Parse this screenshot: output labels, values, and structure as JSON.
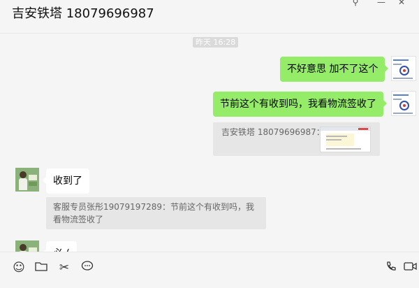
{
  "header": {
    "title": "吉安铁塔 18079696987"
  },
  "window_controls": {
    "pin_icon": "pin-icon",
    "minimize_icon": "minimize-icon",
    "close_icon": "close-icon"
  },
  "chat": {
    "time_label": "昨天 16:28",
    "messages": [
      {
        "side": "right",
        "text": "不好意思 加不了这个"
      },
      {
        "side": "right",
        "text": "节前这个有收到吗，我看物流签收了"
      },
      {
        "side": "right-quote",
        "text": "吉安铁塔 18079696987："
      },
      {
        "side": "left",
        "text": "收到了"
      },
      {
        "side": "left-quote",
        "text": "客服专员张彤19079197289：节前这个有收到吗，我看物流签收了"
      },
      {
        "side": "left",
        "text": "必 ("
      }
    ]
  },
  "toolbar": {
    "icons": [
      "emoji-icon",
      "folder-icon",
      "screenshot-icon",
      "chat-history-icon",
      "phone-icon",
      "video-call-icon"
    ]
  },
  "colors": {
    "background": "#f5f5f5",
    "self_bubble": "#95ec69",
    "other_bubble": "#ffffff",
    "quote_bg": "#e6e6e6"
  }
}
